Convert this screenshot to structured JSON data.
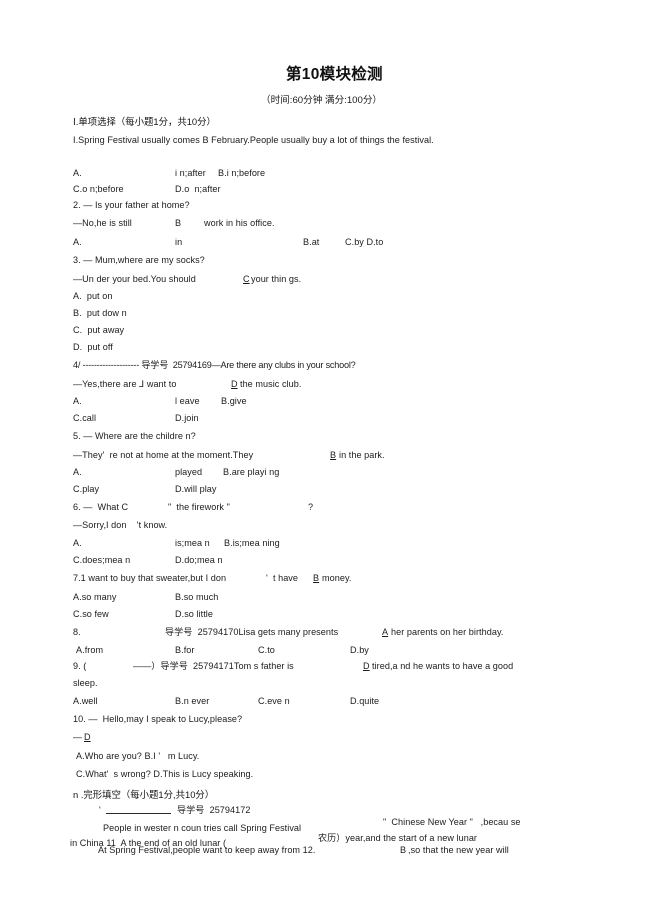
{
  "document": {
    "title": "第10模块检测",
    "subtitle": "（时间:60分钟 满分:100分）",
    "section_one_heading": "Ⅰ.单项选择（每小题1分，共10分）",
    "section_two_heading": "n .完形填空（每小题1分,共10分）"
  },
  "questions": [
    {
      "id": "q1",
      "stem": "I.Spring Festival usually comes B February.People usually buy a lot of things the festival.",
      "answer_mark": "B",
      "options_line_1_a": "A.",
      "options_line_1_b": "i n;after",
      "options_line_1_c": "B.i n;before",
      "options_line_2_a": "C.o n;before",
      "options_line_2_b": "D.o  n;after"
    },
    {
      "id": "q2",
      "stem": "2. — Is your father at home?",
      "reply_left": "—No,he is still",
      "reply_mark": "B",
      "reply_right": "work in his office.",
      "opt_a_label": "A.",
      "opt_a_value": "in",
      "opt_b": "B.at",
      "opt_c_d": "C.by D.to"
    },
    {
      "id": "q3",
      "stem": "3. — Mum,where are my socks?",
      "reply_left": "—Un der your bed.You should",
      "reply_mark": "C",
      "reply_right": "your thin gs.",
      "opt_a": "A.  put on",
      "opt_b": "B.  put dow n",
      "opt_c": "C.  put away",
      "opt_d": "D.  put off"
    },
    {
      "id": "q4",
      "lead": "4/ -------------------- 导学号  25794169—Are there any clubs in your school?",
      "reply_left": "—Yes,there are ⅃ want to",
      "reply_mark": "D",
      "reply_right": "the music club.",
      "opt_line_1_a": "A.",
      "opt_line_1_b": "l eave",
      "opt_line_1_c": "B.give",
      "opt_line_2_a": "C.call",
      "opt_line_2_b": "D.join"
    },
    {
      "id": "q5",
      "stem": "5. — Where are the childre n?",
      "reply_left": "—They'  re not at home at the moment.They",
      "reply_mark": "B",
      "reply_right": "in the park.",
      "opt_line_1_a": "A.",
      "opt_line_1_b": "played",
      "opt_line_1_c": "B.are playi ng",
      "opt_line_2_a": "C.play",
      "opt_line_2_b": "D.will play"
    },
    {
      "id": "q6",
      "stem_left": "6. —  What C",
      "stem_mid": "\"  the firework \"",
      "stem_right": "?",
      "reply": "—Sorry,I don    't know.",
      "opt_line_1_a": "A.",
      "opt_line_1_b": "is;mea n",
      "opt_line_1_c": "B.is;mea ning",
      "opt_line_2_a": "C.does;mea n",
      "opt_line_2_b": "D.do;mea n"
    },
    {
      "id": "q7",
      "stem_left": "7.1 want to buy that sweater,but I don",
      "stem_mid": "'  t have",
      "stem_mark": "B",
      "stem_right": "money.",
      "opt_line_1_a": "A.so many",
      "opt_line_1_b": "B.so much",
      "opt_line_2_a": "C.so few",
      "opt_line_2_b": "D.so little"
    },
    {
      "id": "q8",
      "num": "8.",
      "ref": "导学号  25794170Lisa gets many presents",
      "answer_mark": "A",
      "stem_right": "her parents on her birthday.",
      "opt_a": "A.from",
      "opt_b": "B.for",
      "opt_c": "C.to",
      "opt_d": "D.by"
    },
    {
      "id": "q9",
      "lead": "9. (",
      "lead_dash": "——）导学号  25794171Tom s father is",
      "answer_mark": "D",
      "stem_right": "tired,a nd he wants to have a good",
      "stem_wrap": "sleep.",
      "opt_a": "A.well",
      "opt_b": "B.n ever",
      "opt_c": "C.eve n",
      "opt_d": "D.quite"
    },
    {
      "id": "q10",
      "stem": "10. —  Hello,may I speak to Lucy,please?",
      "reply_dash": "—",
      "answer_mark": "D",
      "opt_line_1": "A.Who are you? B.I '   m Lucy.",
      "opt_line_2": "C.What'  s wrong? D.This is Lucy speaking."
    }
  ],
  "cloze": {
    "ref_prefix": "'",
    "ref": "导学号  25794172",
    "line_1_left": "People in wester n coun tries call Spring Festival",
    "line_1_right": "\"  Chinese New Year \"   ,becau se",
    "line_2_left": "in China 11  A the end of an old lunar (",
    "line_2_mid": "农历）year,and the start of a new lunar",
    "line_3_left": "At Spring Festival,people want to keep away from 12.",
    "line_3_mark": "B",
    "line_3_right": ",so that the new year will"
  }
}
